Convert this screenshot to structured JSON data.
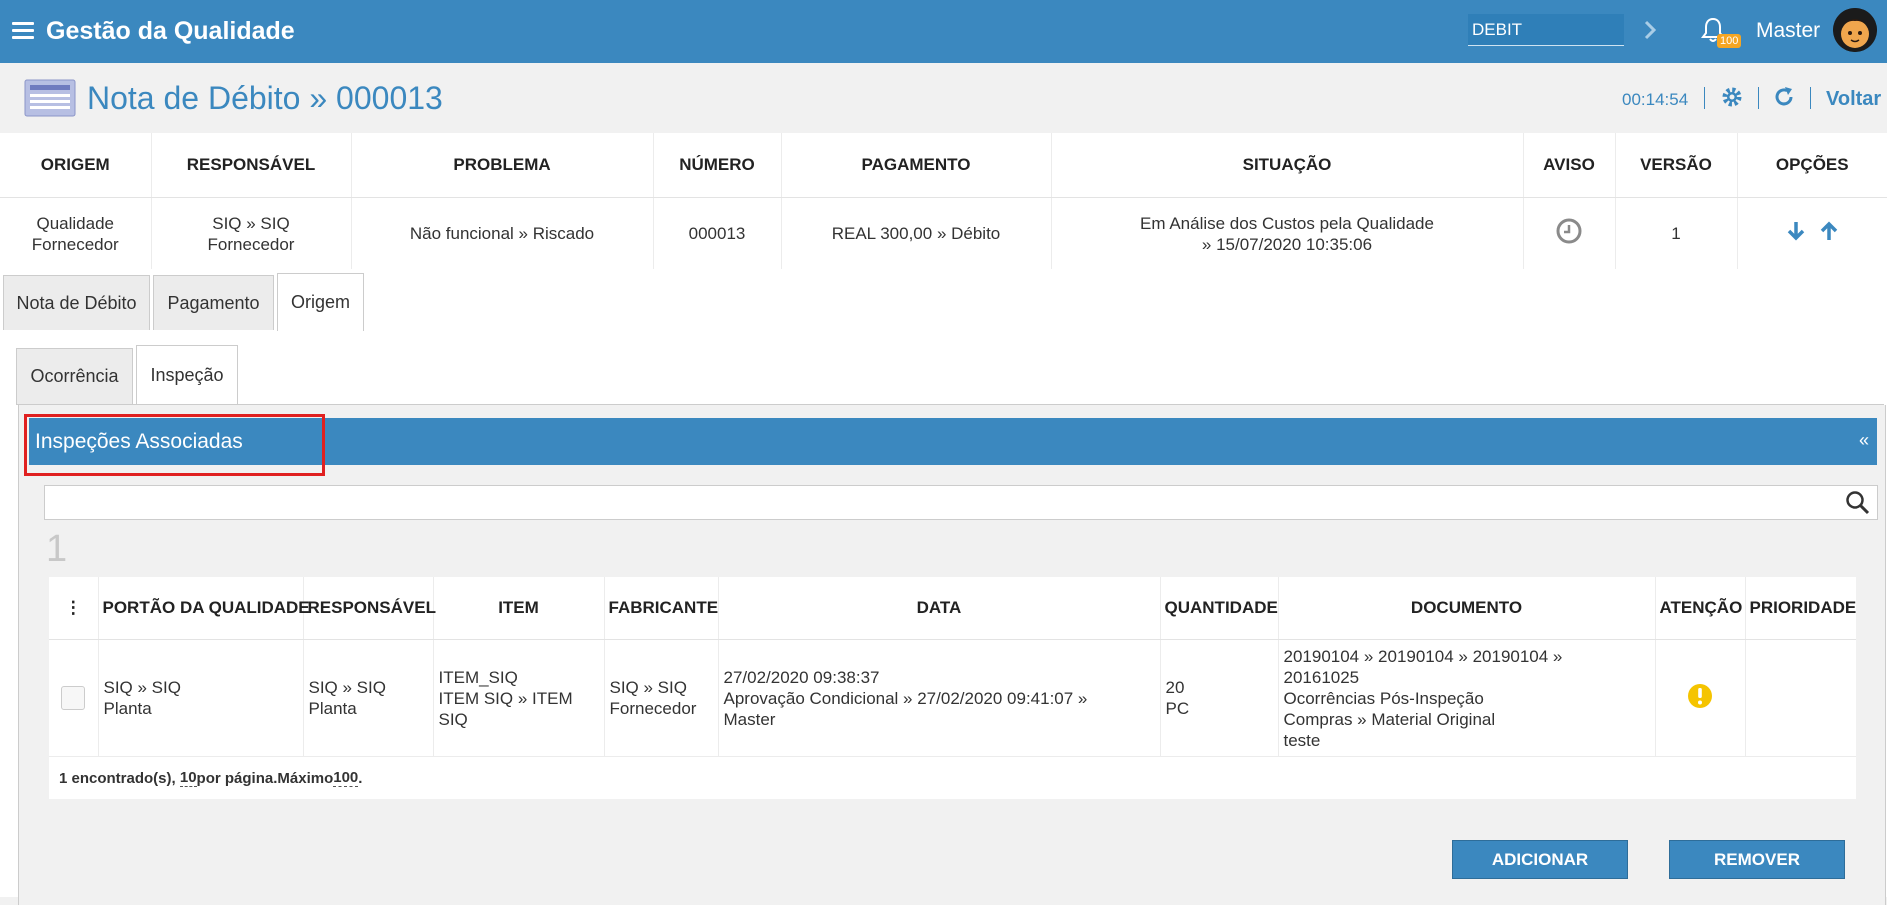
{
  "app": {
    "title": "Gestão da Qualidade"
  },
  "topbar": {
    "environment": "DEBIT",
    "notification_count": "100",
    "user": "Master"
  },
  "page": {
    "title": "Nota de Débito » 000013",
    "timer": "00:14:54",
    "back": "Voltar"
  },
  "summary": {
    "headers": [
      "ORIGEM",
      "RESPONSÁVEL",
      "PROBLEMA",
      "NÚMERO",
      "PAGAMENTO",
      "SITUAÇÃO",
      "AVISO",
      "VERSÃO",
      "OPÇÕES"
    ],
    "origem": [
      "Qualidade",
      "Fornecedor"
    ],
    "responsavel": [
      "SIQ » SIQ",
      "Fornecedor"
    ],
    "problema": "Não funcional » Riscado",
    "numero": "000013",
    "pagamento": "REAL 300,00 » Débito",
    "situacao": [
      "Em Análise dos Custos pela Qualidade",
      "» 15/07/2020 10:35:06"
    ],
    "versao": "1"
  },
  "tabs": [
    "Nota de Débito",
    "Pagamento",
    "Origem"
  ],
  "subtabs": [
    "Ocorrência",
    "Inspeção"
  ],
  "panel": {
    "title": "Inspeções Associadas",
    "collapse": "«"
  },
  "search": {
    "value": ""
  },
  "pagination": {
    "page": "1"
  },
  "grid": {
    "headers": [
      "⋮",
      "PORTÃO DA QUALIDADE",
      "RESPONSÁVEL",
      "ITEM",
      "FABRICANTE",
      "DATA",
      "QUANTIDADE",
      "DOCUMENTO",
      "ATENÇÃO",
      "PRIORIDADE"
    ],
    "row": {
      "portao": [
        "SIQ » SIQ",
        "Planta"
      ],
      "responsavel": [
        "SIQ » SIQ",
        "Planta"
      ],
      "item": [
        "ITEM_SIQ",
        "ITEM SIQ » ITEM",
        "SIQ"
      ],
      "fabricante": [
        "SIQ » SIQ",
        "Fornecedor"
      ],
      "data": [
        "27/02/2020 09:38:37",
        "Aprovação Condicional » 27/02/2020 09:41:07 »",
        "Master"
      ],
      "quantidade": [
        "20",
        "PC"
      ],
      "documento": [
        "20190104 » 20190104 » 20190104 »",
        "20161025",
        "Ocorrências Pós-Inspeção",
        "Compras » Material Original",
        "teste"
      ]
    },
    "footer": {
      "found": "1 encontrado(s), ",
      "per_page": "10",
      "per_page_text": " por página.Máximo ",
      "max": "100",
      "end": "."
    }
  },
  "buttons": {
    "add": "ADICIONAR",
    "remove": "REMOVER"
  },
  "colors": {
    "primary": "#3b88bf",
    "warning": "#f5c400",
    "highlight": "#e02020"
  }
}
